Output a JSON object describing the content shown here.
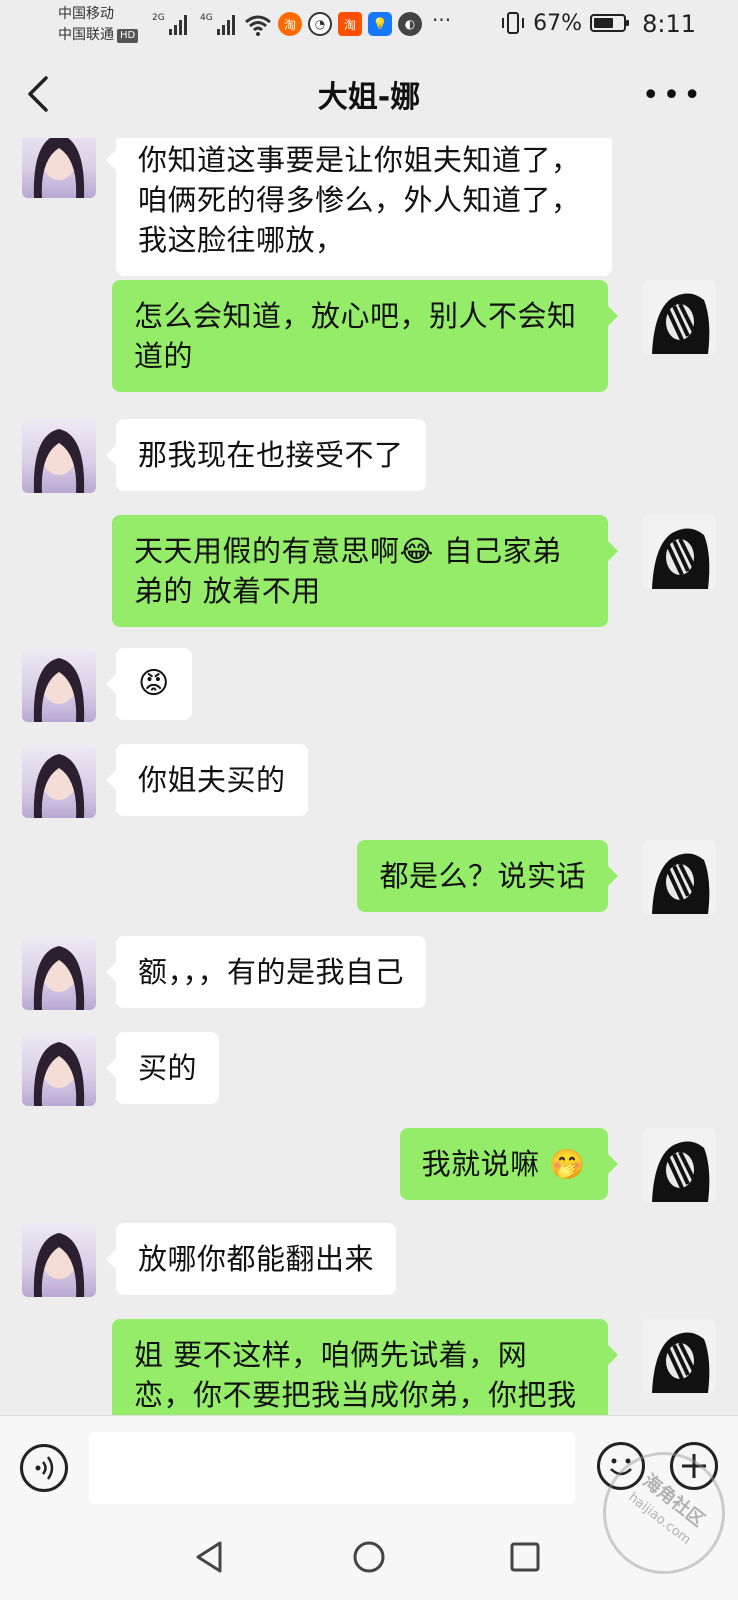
{
  "status_bar": {
    "carrier1": "中国移动",
    "carrier2": "中国联通",
    "hd_badge": "HD",
    "signal1_label": "2G",
    "signal2_label": "4G",
    "battery": "67%",
    "battery_level": 0.67,
    "time": "8:11",
    "icons": [
      "wifi-icon",
      "taobao-icon",
      "browser-icon",
      "taobao-app-icon",
      "idea-bulb-icon",
      "sync-icon",
      "more-dots-icon",
      "vibrate-icon",
      "battery-icon"
    ]
  },
  "header": {
    "title": "大姐-娜",
    "back_icon": "chevron-left-icon",
    "more_icon": "more-horizontal-icon"
  },
  "messages": [
    {
      "side": "left",
      "text": "你知道这事要是让你姐夫知道了，咱俩死的得多惨么，外人知道了，我这脸往哪放，"
    },
    {
      "side": "right",
      "text": "怎么会知道，放心吧，别人不会知道的"
    },
    {
      "side": "left",
      "text": "那我现在也接受不了"
    },
    {
      "side": "right",
      "text": "天天用假的有意思啊😂  自己家弟弟的 放着不用"
    },
    {
      "side": "left",
      "text": "😡"
    },
    {
      "side": "left",
      "text": "你姐夫买的"
    },
    {
      "side": "right",
      "text": "都是么？说实话"
    },
    {
      "side": "left",
      "text": "额，，，有的是我自己"
    },
    {
      "side": "left",
      "text": "买的"
    },
    {
      "side": "right",
      "text": "我就说嘛 🤭"
    },
    {
      "side": "left",
      "text": "放哪你都能翻出来"
    },
    {
      "side": "right",
      "text": "姐 要不这样，咱俩先试着，网恋，你不要把我当成你弟，你把我当"
    }
  ],
  "input_bar": {
    "placeholder": "",
    "voice_icon": "voice-icon",
    "emoji_icon": "emoji-icon",
    "plus_icon": "plus-icon"
  },
  "nav_bar": {
    "icons": [
      "back-triangle-icon",
      "home-circle-icon",
      "recents-square-icon"
    ]
  },
  "watermark": {
    "line1": "海角社区",
    "line2": "haijiao.com"
  },
  "colors": {
    "background": "#ededed",
    "sent_bubble": "#95ec69",
    "received_bubble": "#ffffff"
  }
}
